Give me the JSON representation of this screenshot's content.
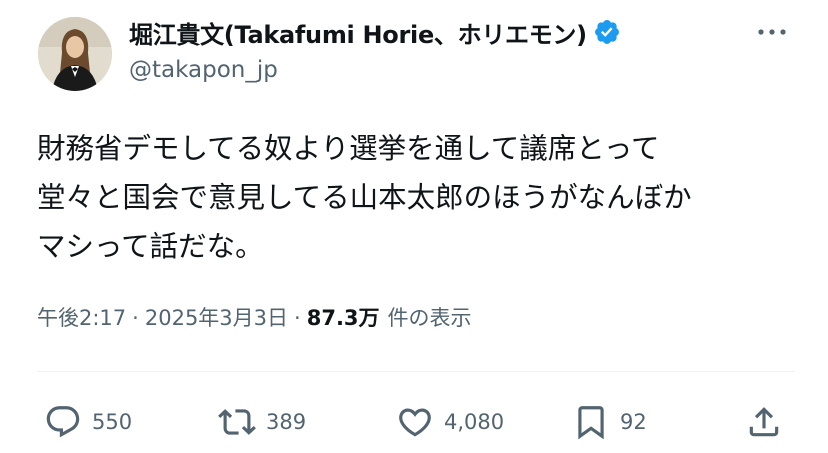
{
  "author": {
    "display_name": "堀江貴文(Takafumi Horie、ホリエモン)",
    "handle": "@takapon_jp",
    "verified": true
  },
  "tweet": {
    "lines": [
      "財務省デモしてる奴より選挙を通して議席とって",
      "堂々と国会で意見してる山本太郎のほうがなんぼか",
      "マシって話だな。"
    ]
  },
  "meta": {
    "time": "午後2:17",
    "separator": "·",
    "date": "2025年3月3日",
    "views_count": "87.3万",
    "views_label": "件の表示"
  },
  "actions": {
    "reply_count": "550",
    "retweet_count": "389",
    "like_count": "4,080",
    "bookmark_count": "92"
  },
  "colors": {
    "verified_badge": "#1d9bf0",
    "secondary_text": "#536471",
    "primary_text": "#0f1419"
  },
  "icons": [
    "more-icon",
    "verified-badge-icon",
    "reply-icon",
    "retweet-icon",
    "like-icon",
    "bookmark-icon",
    "share-icon"
  ]
}
